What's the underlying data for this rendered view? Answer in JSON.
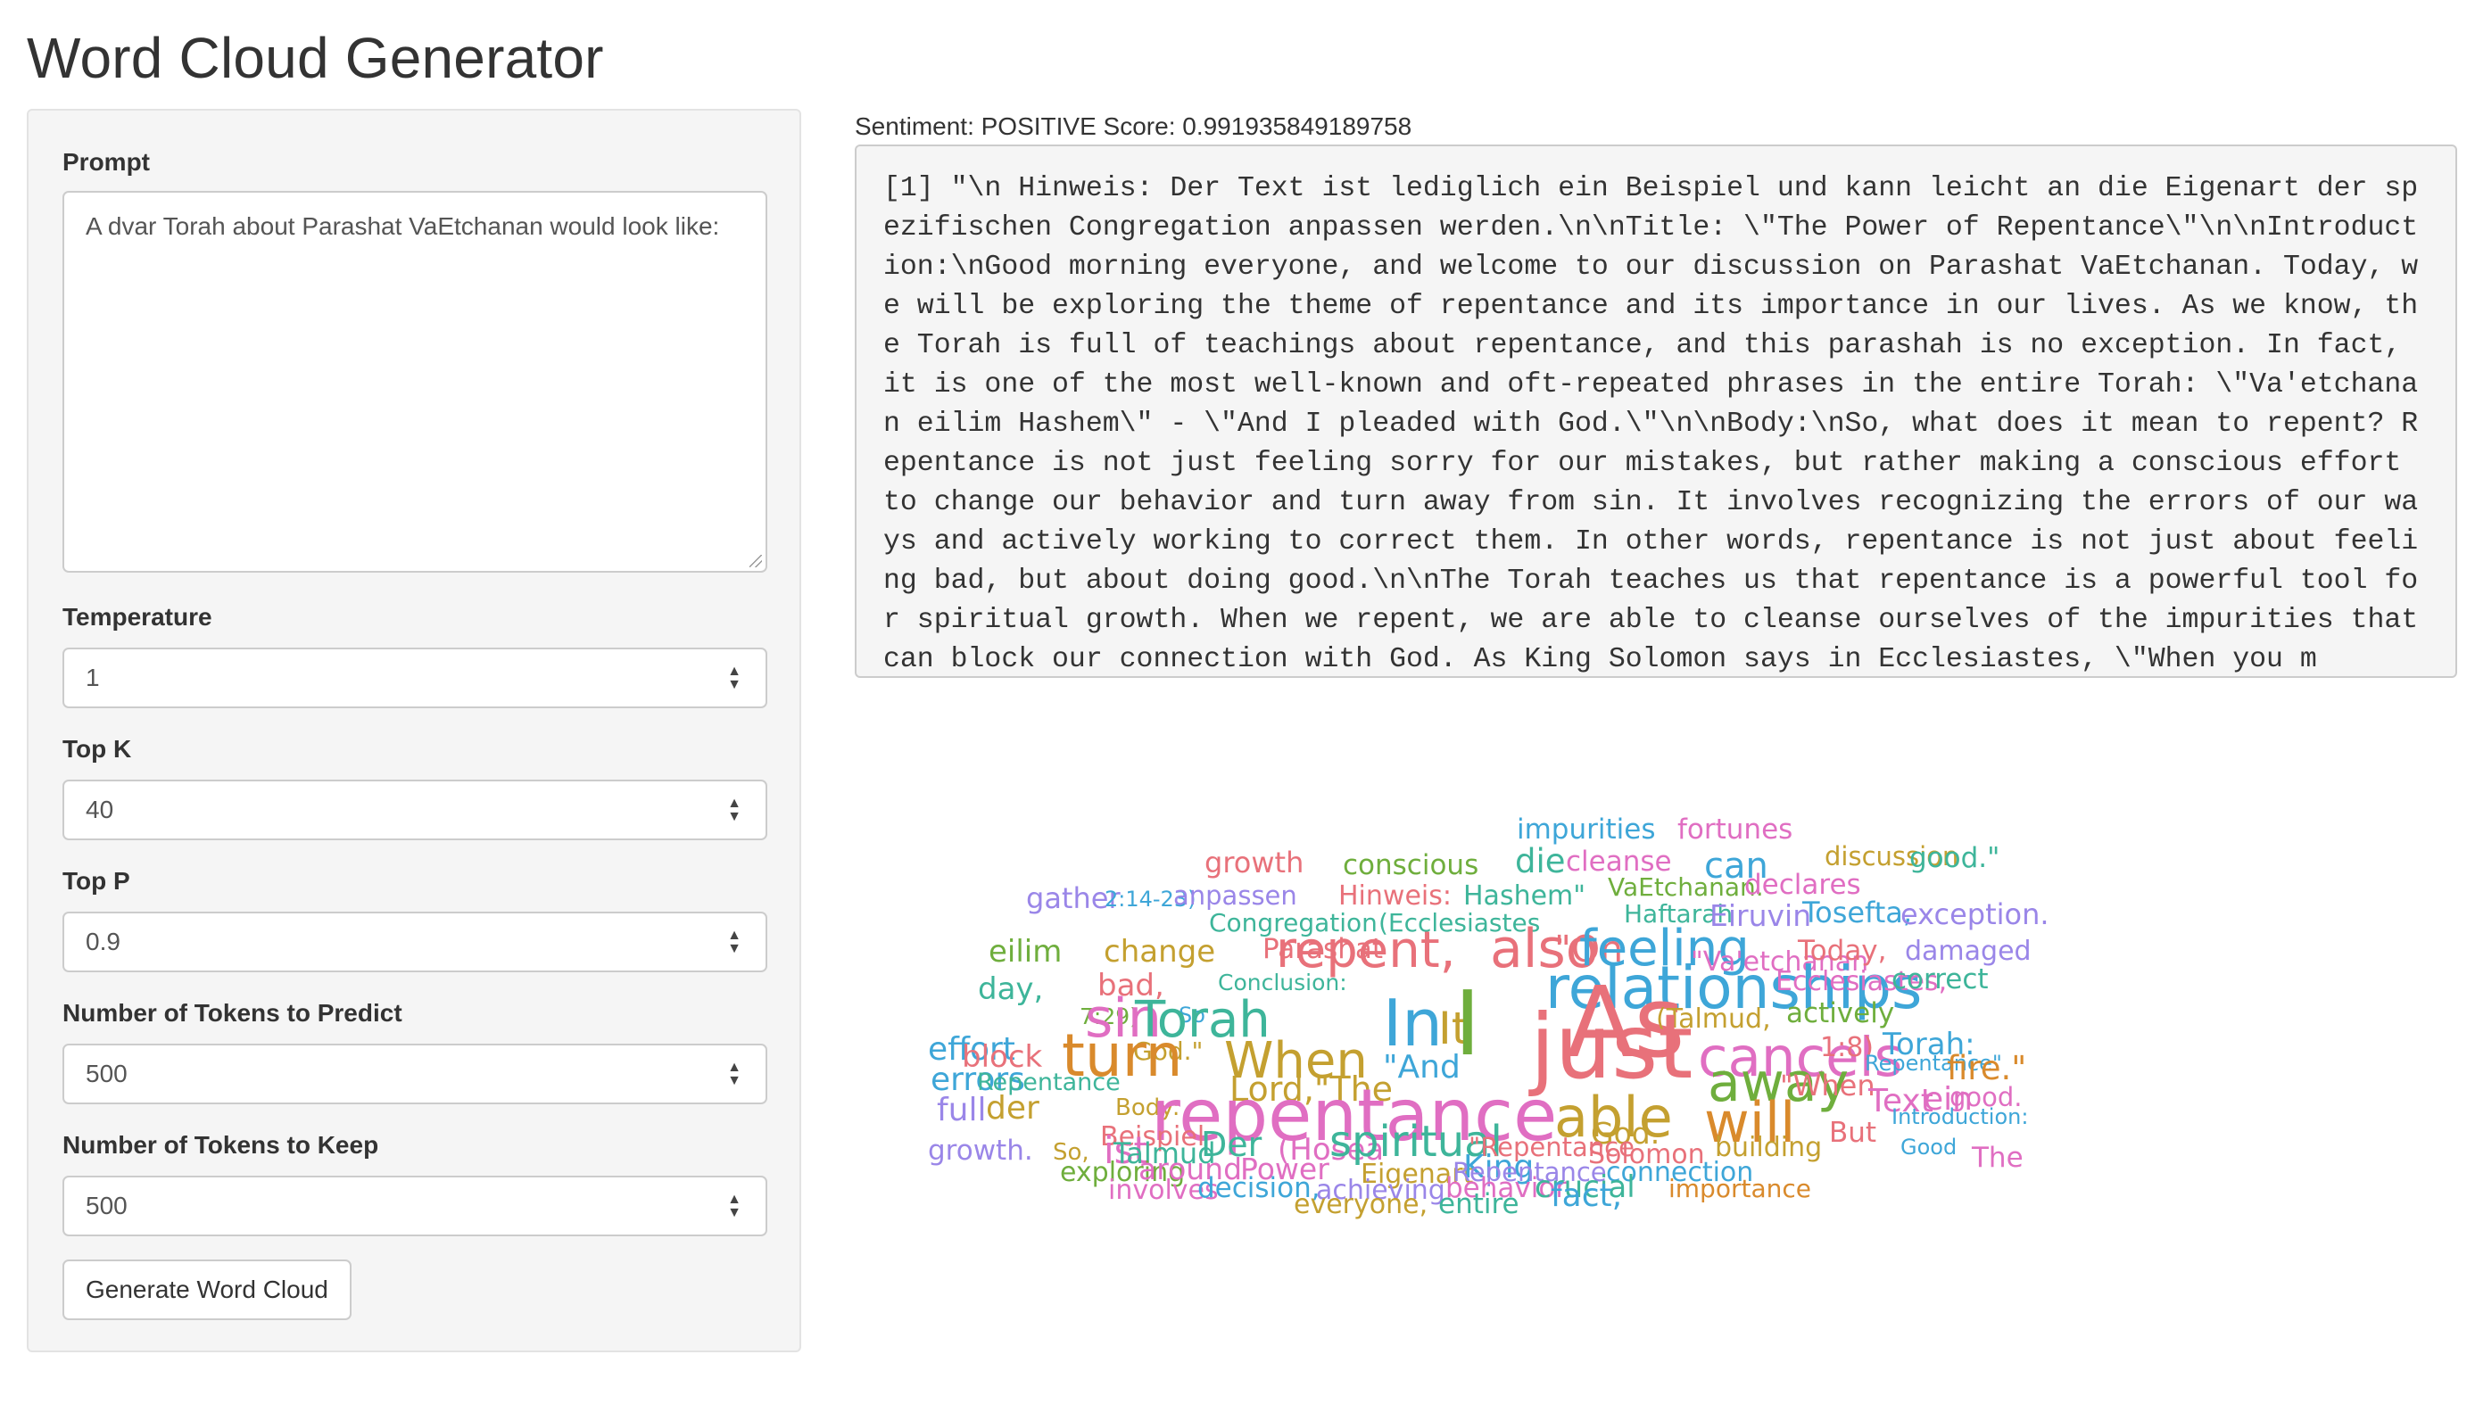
{
  "app": {
    "title": "Word Cloud Generator"
  },
  "sidebar": {
    "prompt": {
      "label": "Prompt",
      "value": "A dvar Torah about Parashat VaEtchanan would look like:"
    },
    "temperature": {
      "label": "Temperature",
      "value": "1"
    },
    "top_k": {
      "label": "Top K",
      "value": "40"
    },
    "top_p": {
      "label": "Top P",
      "value": "0.9"
    },
    "tokens_predict": {
      "label": "Number of Tokens to Predict",
      "value": "500"
    },
    "tokens_keep": {
      "label": "Number of Tokens to Keep",
      "value": "500"
    },
    "generate_label": "Generate Word Cloud"
  },
  "main": {
    "sentiment": "Sentiment: POSITIVE Score: 0.991935849189758",
    "output": "[1] \"\\n Hinweis: Der Text ist lediglich ein Beispiel und kann leicht an die Eigenart der spezifischen Congregation anpassen werden.\\n\\nTitle: \\\"The Power of Repentance\\\"\\n\\nIntroduction:\\nGood morning everyone, and welcome to our discussion on Parashat VaEtchanan. Today, we will be exploring the theme of repentance and its importance in our lives. As we know, the Torah is full of teachings about repentance, and this parashah is no exception. In fact, it is one of the most well-known and oft-repeated phrases in the entire Torah: \\\"Va'etchanan eilim Hashem\\\" - \\\"And I pleaded with God.\\\"\\n\\nBody:\\nSo, what does it mean to repent? Repentance is not just feeling sorry for our mistakes, but rather making a conscious effort to change our behavior and turn away from sin. It involves recognizing the errors of our ways and actively working to correct them. In other words, repentance is not just about feeling bad, but about doing good.\\n\\nThe Torah teaches us that repentance is a powerful tool for spiritual growth. When we repent, we are able to cleanse ourselves of the impurities that can block our connection with God. As King Solomon says in Ecclesiastes, \\\"When you m"
  },
  "wordcloud": {
    "palette": [
      "#e8717a",
      "#c4a030",
      "#6fae3d",
      "#3eb59a",
      "#3ea6d8",
      "#9a86e8",
      "#e06ec2",
      "#d98a2c"
    ],
    "words": [
      {
        "text": "impurities",
        "color": "#3ea6d8"
      },
      {
        "text": "fortunes",
        "color": "#e06ec2"
      },
      {
        "text": "growth",
        "color": "#e8717a"
      },
      {
        "text": "conscious",
        "color": "#6fae3d"
      },
      {
        "text": "die",
        "color": "#3eb59a"
      },
      {
        "text": "cleanse",
        "color": "#e06ec2"
      },
      {
        "text": "can",
        "color": "#3ea6d8"
      },
      {
        "text": "discussion",
        "color": "#c4a030"
      },
      {
        "text": "good.\"",
        "color": "#3eb59a"
      },
      {
        "text": "gather",
        "color": "#9a86e8"
      },
      {
        "text": "2:14-23)",
        "color": "#3ea6d8"
      },
      {
        "text": "anpassen",
        "color": "#9a86e8"
      },
      {
        "text": "Hinweis:",
        "color": "#e8717a"
      },
      {
        "text": "Hashem\"",
        "color": "#3eb59a"
      },
      {
        "text": "VaEtchanan.",
        "color": "#6fae3d"
      },
      {
        "text": "declares",
        "color": "#e06ec2"
      },
      {
        "text": "Congregation",
        "color": "#3eb59a"
      },
      {
        "text": "(Ecclesiastes",
        "color": "#3eb59a"
      },
      {
        "text": "Haftarah",
        "color": "#3eb59a"
      },
      {
        "text": "Eiruvin",
        "color": "#9a86e8"
      },
      {
        "text": "Tosefta,",
        "color": "#3ea6d8"
      },
      {
        "text": "exception.",
        "color": "#9a86e8"
      },
      {
        "text": "eilim",
        "color": "#6fae3d"
      },
      {
        "text": "change",
        "color": "#c4a030"
      },
      {
        "text": "Parashat",
        "color": "#e8717a"
      },
      {
        "text": "repent,",
        "color": "#e8717a"
      },
      {
        "text": "also",
        "color": "#e8717a"
      },
      {
        "text": "\"On",
        "color": "#e8717a"
      },
      {
        "text": "feeling",
        "color": "#3ea6d8"
      },
      {
        "text": "\"Va'etchanan",
        "color": "#e06ec2"
      },
      {
        "text": "Today,",
        "color": "#e8717a"
      },
      {
        "text": "damaged",
        "color": "#9a86e8"
      },
      {
        "text": "day,",
        "color": "#3eb59a"
      },
      {
        "text": "bad,",
        "color": "#e8717a"
      },
      {
        "text": "Conclusion:",
        "color": "#3eb59a"
      },
      {
        "text": "relationships",
        "color": "#3ea6d8"
      },
      {
        "text": "Ecclesiastes,",
        "color": "#e06ec2"
      },
      {
        "text": "correct",
        "color": "#3eb59a"
      },
      {
        "text": "7:29)",
        "color": "#6fae3d"
      },
      {
        "text": "So",
        "color": "#3ea6d8"
      },
      {
        "text": "sin",
        "color": "#e06ec2"
      },
      {
        "text": "Torah",
        "color": "#3eb59a"
      },
      {
        "text": "In",
        "color": "#3ea6d8"
      },
      {
        "text": "It",
        "color": "#c4a030"
      },
      {
        "text": "I",
        "color": "#6fae3d"
      },
      {
        "text": "As",
        "color": "#e8717a"
      },
      {
        "text": "(Talmud,",
        "color": "#c4a030"
      },
      {
        "text": "actively",
        "color": "#6fae3d"
      },
      {
        "text": "effort",
        "color": "#3ea6d8"
      },
      {
        "text": "block",
        "color": "#e8717a"
      },
      {
        "text": "God.\"",
        "color": "#c4a030"
      },
      {
        "text": "turn",
        "color": "#d98a2c"
      },
      {
        "text": "When",
        "color": "#c4a030"
      },
      {
        "text": "\"And",
        "color": "#3ea6d8"
      },
      {
        "text": "just",
        "color": "#e8717a"
      },
      {
        "text": "cancels",
        "color": "#e06ec2"
      },
      {
        "text": "1:8)",
        "color": "#e8717a"
      },
      {
        "text": "Torah:",
        "color": "#3ea6d8"
      },
      {
        "text": "errors",
        "color": "#3ea6d8"
      },
      {
        "text": "Repentance",
        "color": "#3eb59a"
      },
      {
        "text": "Lord,\"The",
        "color": "#c4a030"
      },
      {
        "text": "away",
        "color": "#6fae3d"
      },
      {
        "text": "\"When",
        "color": "#e8717a"
      },
      {
        "text": "Repentance\"",
        "color": "#3ea6d8"
      },
      {
        "text": "fire.\"",
        "color": "#d98a2c"
      },
      {
        "text": "full",
        "color": "#9a86e8"
      },
      {
        "text": "der",
        "color": "#c4a030"
      },
      {
        "text": "Body:",
        "color": "#c4a030"
      },
      {
        "text": "repentance",
        "color": "#e06ec2"
      },
      {
        "text": "able",
        "color": "#c4a030"
      },
      {
        "text": "will",
        "color": "#d98a2c"
      },
      {
        "text": "Text",
        "color": "#e06ec2"
      },
      {
        "text": "ein",
        "color": "#e06ec2"
      },
      {
        "text": "good.",
        "color": "#e06ec2"
      },
      {
        "text": "Beispiel",
        "color": "#e8717a"
      },
      {
        "text": "God.",
        "color": "#c4a030"
      },
      {
        "text": "But",
        "color": "#e8717a"
      },
      {
        "text": "Introduction:",
        "color": "#3ea6d8"
      },
      {
        "text": "growth.",
        "color": "#9a86e8"
      },
      {
        "text": "So,",
        "color": "#c4a030"
      },
      {
        "text": "ist",
        "color": "#e06ec2"
      },
      {
        "text": "Talmud",
        "color": "#3eb59a"
      },
      {
        "text": "Der",
        "color": "#3eb59a"
      },
      {
        "text": "(Hosea",
        "color": "#e06ec2"
      },
      {
        "text": "spiritual",
        "color": "#3eb59a"
      },
      {
        "text": "\"Repentance",
        "color": "#e8717a"
      },
      {
        "text": "Solomon",
        "color": "#e8717a"
      },
      {
        "text": "building",
        "color": "#c4a030"
      },
      {
        "text": "Good",
        "color": "#3ea6d8"
      },
      {
        "text": "The",
        "color": "#e06ec2"
      },
      {
        "text": "exploring",
        "color": "#6fae3d"
      },
      {
        "text": "around",
        "color": "#e06ec2"
      },
      {
        "text": "Power",
        "color": "#e06ec2"
      },
      {
        "text": "Eigenart",
        "color": "#c4a030"
      },
      {
        "text": "King",
        "color": "#3ea6d8"
      },
      {
        "text": "Repentance",
        "color": "#9a86e8"
      },
      {
        "text": "connection",
        "color": "#3ea6d8"
      },
      {
        "text": "involves",
        "color": "#e06ec2"
      },
      {
        "text": "decision,",
        "color": "#3ea6d8"
      },
      {
        "text": "achieving",
        "color": "#9a86e8"
      },
      {
        "text": "behavior",
        "color": "#e06ec2"
      },
      {
        "text": "crucial",
        "color": "#3eb59a"
      },
      {
        "text": "importance",
        "color": "#d98a2c"
      },
      {
        "text": "everyone,",
        "color": "#c4a030"
      },
      {
        "text": "entire",
        "color": "#3eb59a"
      },
      {
        "text": "fact,",
        "color": "#3ea6d8"
      }
    ]
  }
}
